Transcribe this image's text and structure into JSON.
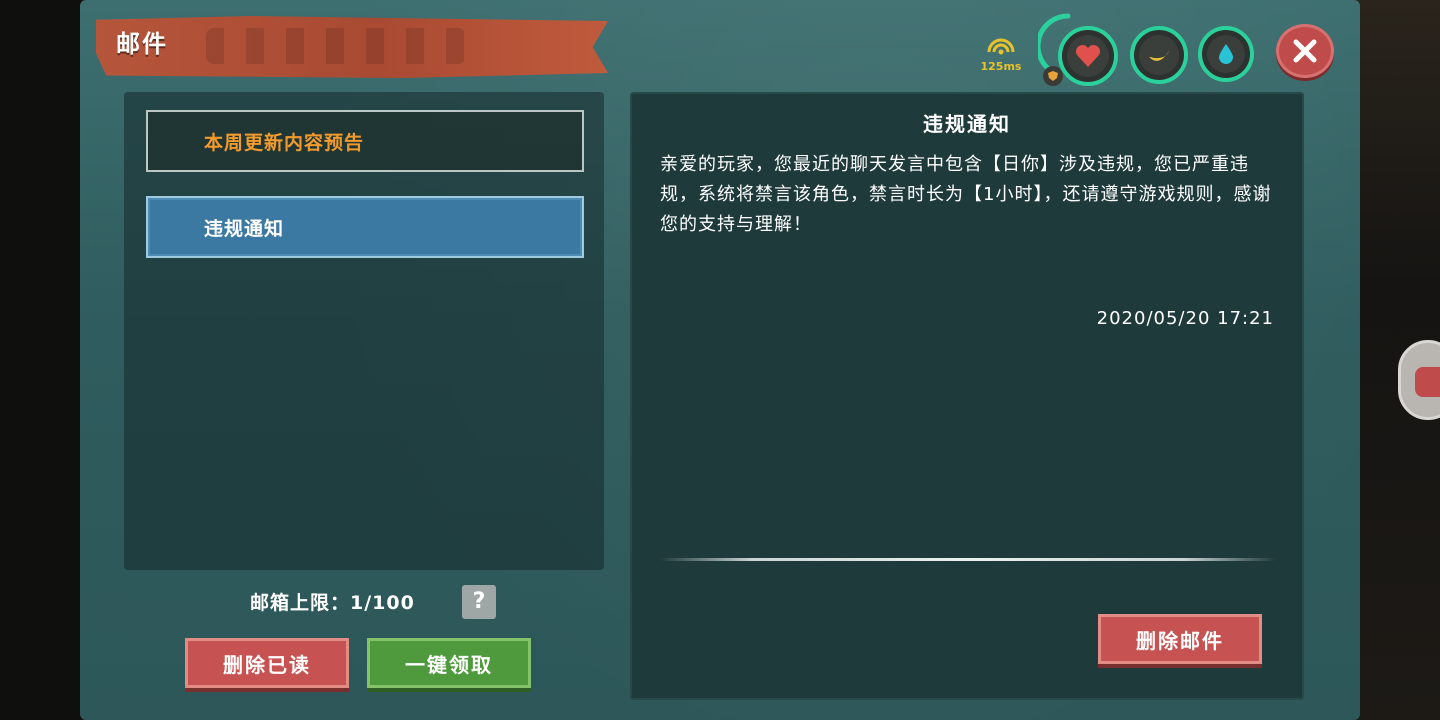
{
  "window": {
    "title": "邮件"
  },
  "status_bar": {
    "ping": "125ms",
    "icons": [
      "wifi-signal-icon",
      "heart-icon",
      "banana-icon",
      "water-drop-icon",
      "shield-icon"
    ],
    "colors": {
      "ring": "#2bd19b",
      "ping": "#e7c22c",
      "heart": "#e0514e",
      "banana": "#e8c23a",
      "water": "#29c3d6"
    }
  },
  "mail_list": {
    "items": [
      {
        "label": "本周更新内容预告",
        "state": "unread"
      },
      {
        "label": "违规通知",
        "state": "selected"
      }
    ],
    "capacity_label": "邮箱上限：1/100",
    "help_label": "?",
    "delete_read_label": "删除已读",
    "claim_all_label": "一键领取"
  },
  "mail_detail": {
    "title": "违规通知",
    "body": "亲爱的玩家，您最近的聊天发言中包含【日你】涉及违规，您已严重违规，系统将禁言该角色，禁言时长为【1小时】，还请遵守游戏规则，感谢您的支持与理解！",
    "date": "2020/05/20 17:21",
    "delete_label": "删除邮件"
  },
  "colors": {
    "panel": "#2f5c5e",
    "accent_orange": "#f39a2c",
    "selected_blue": "#3c79a2",
    "button_red": "#c65352",
    "button_green": "#4f9a3c"
  }
}
